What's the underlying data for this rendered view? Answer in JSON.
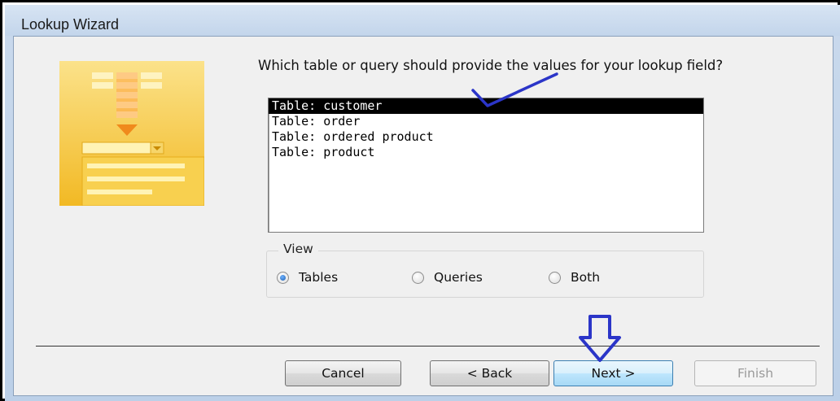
{
  "window": {
    "title": "Lookup Wizard"
  },
  "prompt": {
    "question": "Which table or query should provide the values for your lookup field?"
  },
  "list": {
    "items": [
      {
        "label": "Table: customer",
        "selected": true
      },
      {
        "label": "Table: order",
        "selected": false
      },
      {
        "label": "Table: ordered product",
        "selected": false
      },
      {
        "label": "Table: product",
        "selected": false
      }
    ]
  },
  "view": {
    "legend": "View",
    "options": [
      {
        "label": "Tables",
        "selected": true
      },
      {
        "label": "Queries",
        "selected": false
      },
      {
        "label": "Both",
        "selected": false
      }
    ]
  },
  "buttons": {
    "cancel": "Cancel",
    "back": "< Back",
    "next": "Next >",
    "finish": "Finish"
  },
  "icons": {
    "wizard_art": "lookup-wizard-illustration",
    "annotation_check": "checkmark",
    "annotation_arrow": "down-arrow"
  },
  "colors": {
    "selection": "#000000",
    "annotation": "#2b35c8",
    "art": "#f5c842"
  }
}
